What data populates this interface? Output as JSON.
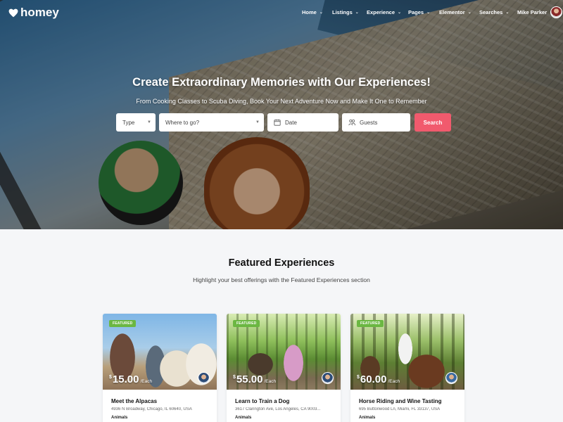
{
  "brand": {
    "logo_text": "homey"
  },
  "nav": {
    "items": [
      {
        "label": "Home"
      },
      {
        "label": "Listings"
      },
      {
        "label": "Experience"
      },
      {
        "label": "Pages"
      },
      {
        "label": "Elementor"
      },
      {
        "label": "Searches"
      }
    ],
    "user_name": "Mike Parker"
  },
  "hero": {
    "title": "Create Extraordinary Memories with Our Experiences!",
    "subtitle": "From Cooking Classes to Scuba Diving, Book Your Next Adventure Now and Make It One to Remember"
  },
  "search": {
    "type_label": "Type",
    "where_label": "Where to go?",
    "date_label": "Date",
    "guests_label": "Guests",
    "button_label": "Search"
  },
  "featured": {
    "title": "Featured Experiences",
    "subtitle": "Highlight your best offerings with the Featured Experiences section",
    "cards": [
      {
        "badge": "FEATURED",
        "currency": "$",
        "amount": "15.00",
        "unit": "/Each",
        "name": "Meet the Alpacas",
        "address": "4936 N Broadway, Chicago, IL 60640, USA",
        "category": "Animals"
      },
      {
        "badge": "FEATURED",
        "currency": "$",
        "amount": "55.00",
        "unit": "/Each",
        "name": "Learn to Train a Dog",
        "address": "3617 Clarington Ave, Los Angeles, CA 9003...",
        "category": "Animals"
      },
      {
        "badge": "FEATURED",
        "currency": "$",
        "amount": "60.00",
        "unit": "/Each",
        "name": "Horse Riding and Wine Tasting",
        "address": "695 Buttonwood Ln, Miami, FL 33137, USA",
        "category": "Animals"
      }
    ]
  },
  "colors": {
    "accent": "#f15a6d",
    "badge": "#6bb742"
  },
  "icons": [
    "heart-logo-icon",
    "chevron-down-icon",
    "calendar-icon",
    "guests-icon"
  ]
}
